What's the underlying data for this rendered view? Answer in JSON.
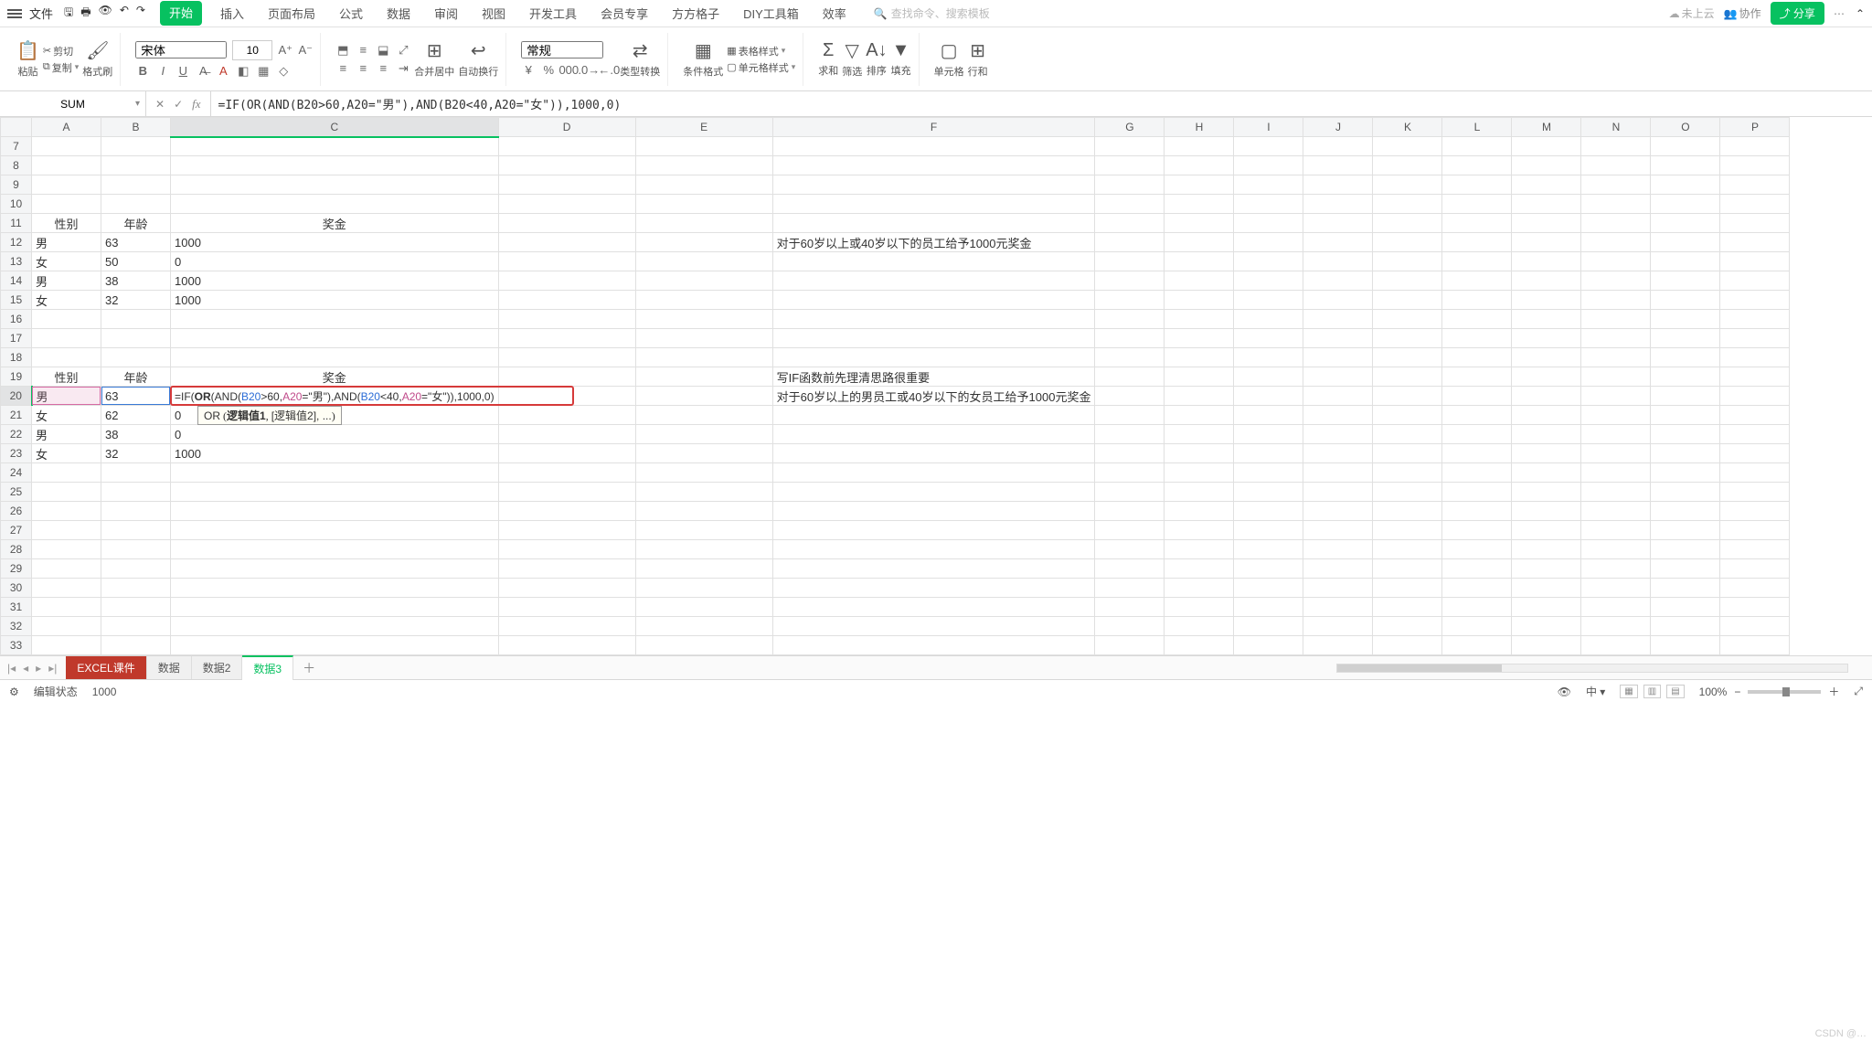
{
  "menubar": {
    "file": "文件",
    "tabs": [
      "开始",
      "插入",
      "页面布局",
      "公式",
      "数据",
      "审阅",
      "视图",
      "开发工具",
      "会员专享",
      "方方格子",
      "DIY工具箱",
      "效率"
    ],
    "active_tab_index": 0,
    "search_placeholder": "查找命令、搜索模板",
    "cloud": "未上云",
    "collab": "协作",
    "share": "分享"
  },
  "ribbon": {
    "paste": "粘贴",
    "cut": "剪切",
    "copy": "复制",
    "format_painter": "格式刷",
    "font_name": "宋体",
    "font_size": "10",
    "merge": "合并居中",
    "wrap": "自动换行",
    "number_format": "常规",
    "type_convert": "类型转换",
    "cond_format": "条件格式",
    "table_style": "表格样式",
    "cell_style": "单元格样式",
    "sum": "求和",
    "filter": "筛选",
    "sort": "排序",
    "fill": "填充",
    "cell": "单元格",
    "row": "行和"
  },
  "formula_bar": {
    "namebox": "SUM",
    "formula": "=IF(OR(AND(B20>60,A20=\"男\"),AND(B20<40,A20=\"女\")),1000,0)"
  },
  "columns": [
    "A",
    "B",
    "C",
    "D",
    "E",
    "F",
    "G",
    "H",
    "I",
    "J",
    "K",
    "L",
    "M",
    "N",
    "O",
    "P"
  ],
  "row_start": 7,
  "row_end": 33,
  "active_col": "C",
  "active_row": 20,
  "cells": {
    "A11": "性别",
    "B11": "年龄",
    "C11": "奖金",
    "A12": "男",
    "B12": "63",
    "C12": "1000",
    "A13": "女",
    "B13": "50",
    "C13": "0",
    "A14": "男",
    "B14": "38",
    "C14": "1000",
    "A15": "女",
    "B15": "32",
    "C15": "1000",
    "F12_long": "对于60岁以上或40岁以下的员工给予1000元奖金",
    "A19": "性别",
    "B19": "年龄",
    "C19": "奖金",
    "A20": "男",
    "B20": "63",
    "A21": "女",
    "B21": "62",
    "C21": "0",
    "A22": "男",
    "B22": "38",
    "C22": "0",
    "A23": "女",
    "B23": "32",
    "C23": "1000",
    "F19_long": "写IF函数前先理清思路很重要",
    "F20_long": "对于60岁以上的男员工或40岁以下的女员工给予1000元奖金"
  },
  "formula_tooltip": {
    "fn": "OR",
    "arg1": "逻辑值1",
    "arg2": "[逻辑值2]",
    "etc": ", ..."
  },
  "cell_formula_parts": {
    "p1": "=IF(",
    "fn_or": "OR",
    "p2": "(AND(",
    "ref_b1": "B20",
    "p3": ">60,",
    "ref_a1": "A20",
    "p4": "=\"男\"),AND(",
    "ref_b2": "B20",
    "p5": "<40,",
    "ref_a2": "A20",
    "p6": "=\"女\")),1000,0)"
  },
  "sheet_tabs": {
    "tabs": [
      "EXCEL课件",
      "数据",
      "数据2",
      "数据3"
    ],
    "red_index": 0,
    "active_index": 3
  },
  "status_bar": {
    "mode": "编辑状态",
    "info": "1000",
    "zoom": "100%"
  },
  "watermark": "CSDN @…"
}
